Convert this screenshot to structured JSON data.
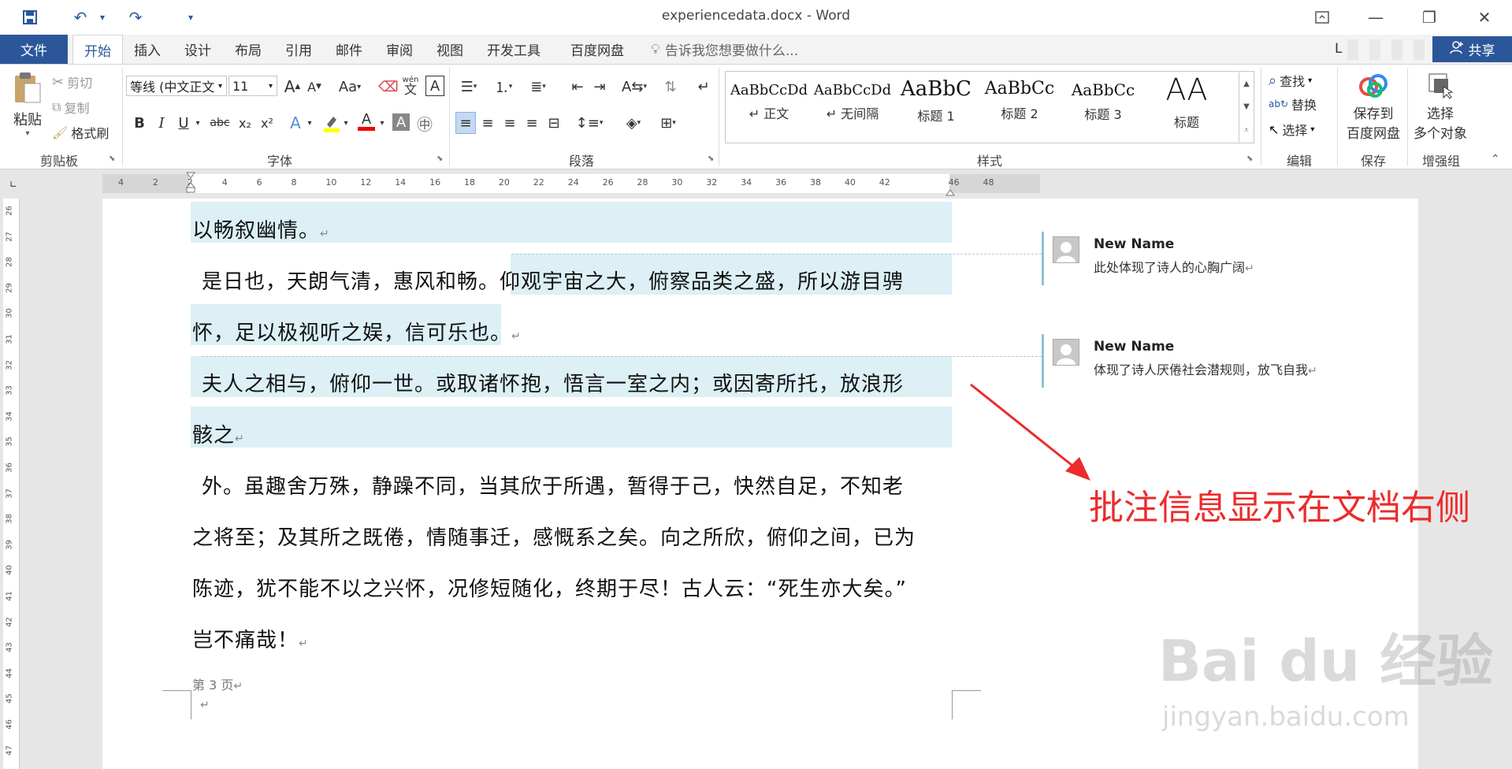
{
  "titlebar": {
    "title": "experiencedata.docx - Word"
  },
  "tabs": {
    "file": "文件",
    "items": [
      "开始",
      "插入",
      "设计",
      "布局",
      "引用",
      "邮件",
      "审阅",
      "视图",
      "开发工具",
      "百度网盘"
    ],
    "tell_me": "告诉我您想要做什么...",
    "share": "共享",
    "user_initial": "L"
  },
  "ribbon": {
    "clipboard": {
      "paste": "粘贴",
      "cut": "剪切",
      "copy": "复制",
      "format_painter": "格式刷",
      "label": "剪贴板"
    },
    "font": {
      "name": "等线 (中文正文",
      "size": "11",
      "label": "字体",
      "grow": "A",
      "shrink": "A",
      "case": "Aa",
      "phonetic": "wén",
      "bold": "B",
      "italic": "I",
      "underline": "U",
      "strike": "abc",
      "sub": "x₂",
      "sup": "x²"
    },
    "paragraph": {
      "label": "段落"
    },
    "styles": {
      "label": "样式",
      "items": [
        {
          "preview": "AaBbCcDd",
          "name": "↵ 正文"
        },
        {
          "preview": "AaBbCcDd",
          "name": "↵ 无间隔"
        },
        {
          "preview": "AaBbC",
          "name": "标题 1"
        },
        {
          "preview": "AaBbCc",
          "name": "标题 2"
        },
        {
          "preview": "AaBbCc",
          "name": "标题 3"
        },
        {
          "preview": "AA",
          "name": "标题"
        }
      ]
    },
    "editing": {
      "find": "查找",
      "replace": "替换",
      "select": "选择",
      "label": "编辑"
    },
    "save": {
      "line1": "保存到",
      "line2": "百度网盘",
      "label": "保存"
    },
    "enhance": {
      "line1": "选择",
      "line2": "多个对象",
      "label": "增强组"
    }
  },
  "ruler": {
    "h_ticks": [
      "4",
      "2",
      "2",
      "4",
      "6",
      "8",
      "10",
      "12",
      "14",
      "16",
      "18",
      "20",
      "22",
      "24",
      "26",
      "28",
      "30",
      "32",
      "34",
      "36",
      "38",
      "40",
      "42",
      "46",
      "48"
    ],
    "v_ticks": [
      "26",
      "27",
      "28",
      "29",
      "30",
      "31",
      "32",
      "33",
      "34",
      "35",
      "36",
      "37",
      "38",
      "39",
      "40",
      "41",
      "42",
      "43",
      "44",
      "45",
      "46",
      "47"
    ]
  },
  "document": {
    "lines": [
      "以畅叙幽情。",
      "是日也，天朗气清，惠风和畅。",
      "仰观宇宙之大，俯察品类之盛，所以游目骋",
      "怀，足以极视听之娱，信可乐也",
      "。",
      "夫人之相与，俯仰一世。或取诸怀抱，悟言一室之内；或因寄所托，放浪形",
      "骸之",
      "外。虽趣舍万殊，静躁不同，当其欣于所遇，暂得于己，快然自足，不知老",
      "之将至；及其所之既倦，情随事迁，感慨系之矣。向之所欣，俯仰之间，已为",
      "陈迹，犹不能不以之兴怀，况修短随化，终期于尽！古人云：“死生亦大矣。”",
      "岂不痛哉！"
    ],
    "footer": "第 3 页",
    "para_mark": "↵"
  },
  "comments": [
    {
      "author": "New Name",
      "text": "此处体现了诗人的心胸广阔"
    },
    {
      "author": "New Name",
      "text": "体现了诗人厌倦社会潜规则，放飞自我"
    }
  ],
  "annotation": "批注信息显示在文档右侧",
  "watermark": {
    "brand": "Bai du 经验",
    "url": "jingyan.baidu.com"
  },
  "colors": {
    "accent": "#2b579a",
    "highlight": "#dcf0f5",
    "annotation": "#ec2b2b"
  }
}
